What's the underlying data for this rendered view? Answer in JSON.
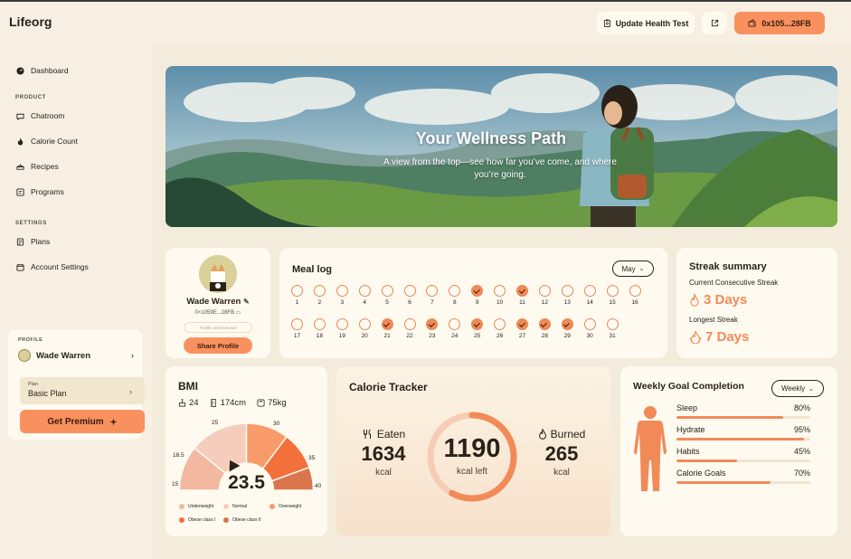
{
  "app": {
    "brand": "Lifeorg"
  },
  "header": {
    "update_test_label": "Update Health Test",
    "wallet_label": "0x105...28FB"
  },
  "sidebar": {
    "dashboard": "Dashboard",
    "product_heading": "PRODUCT",
    "product_items": [
      "Chatroom",
      "Calorie Count",
      "Recipes",
      "Programs"
    ],
    "settings_heading": "SETTINGS",
    "settings_items": [
      "Plans",
      "Account Settings"
    ],
    "profile": {
      "heading": "PROFILE",
      "name": "Wade Warren",
      "plan_label": "Plan",
      "plan_value": "Basic Plan",
      "premium_button": "Get Premium"
    }
  },
  "hero": {
    "title": "Your Wellness Path",
    "subtitle": "A view from the top—see how far you’ve come, and where you’re going."
  },
  "profile_card": {
    "name": "Wade Warren",
    "address": "0×1059E...28FB",
    "link_placeholder": "Profile Link/Onboard",
    "share_button": "Share Profile"
  },
  "meal_log": {
    "title": "Meal log",
    "month": "May",
    "days_row1": [
      1,
      2,
      3,
      4,
      5,
      6,
      7,
      8,
      9,
      10,
      11,
      12,
      13,
      14,
      15,
      16
    ],
    "days_row2": [
      17,
      18,
      19,
      20,
      21,
      22,
      23,
      24,
      25,
      26,
      27,
      28,
      29,
      30,
      31
    ],
    "completed_days": [
      9,
      11,
      21,
      23,
      25,
      27,
      28,
      29
    ]
  },
  "streak": {
    "title": "Streak summary",
    "current_label": "Current Consecutive Streak",
    "current_value": "3 Days",
    "longest_label": "Longest Streak",
    "longest_value": "7 Days"
  },
  "bmi": {
    "title": "BMI",
    "age": "24",
    "height": "174cm",
    "weight": "75kg",
    "value": "23.5",
    "gauge_labels": [
      "15",
      "18.5",
      "25",
      "30",
      "35",
      "40"
    ],
    "legend": [
      {
        "label": "Underweight",
        "color": "#f2b8a0"
      },
      {
        "label": "Normal",
        "color": "#f6cdbd"
      },
      {
        "label": "Overweight",
        "color": "#f89a6a"
      },
      {
        "label": "Obese class I",
        "color": "#f3703a"
      },
      {
        "label": "Obese class II",
        "color": "#d9764d"
      }
    ]
  },
  "calorie": {
    "title": "Calorie Tracker",
    "eaten_label": "Eaten",
    "eaten_value": "1634",
    "eaten_unit": "kcal",
    "left_value": "1190",
    "left_unit": "kcal left",
    "burned_label": "Burned",
    "burned_value": "265",
    "burned_unit": "kcal",
    "ring_progress": 0.58
  },
  "weekly": {
    "title": "Weekly Goal Completion",
    "period": "Weekly",
    "goals": [
      {
        "label": "Sleep",
        "value": "80%",
        "pct": 0.8
      },
      {
        "label": "Hydrate",
        "value": "95%",
        "pct": 0.95
      },
      {
        "label": "Habits",
        "value": "45%",
        "pct": 0.45
      },
      {
        "label": "Calorie Goals",
        "value": "70%",
        "pct": 0.7
      }
    ]
  }
}
